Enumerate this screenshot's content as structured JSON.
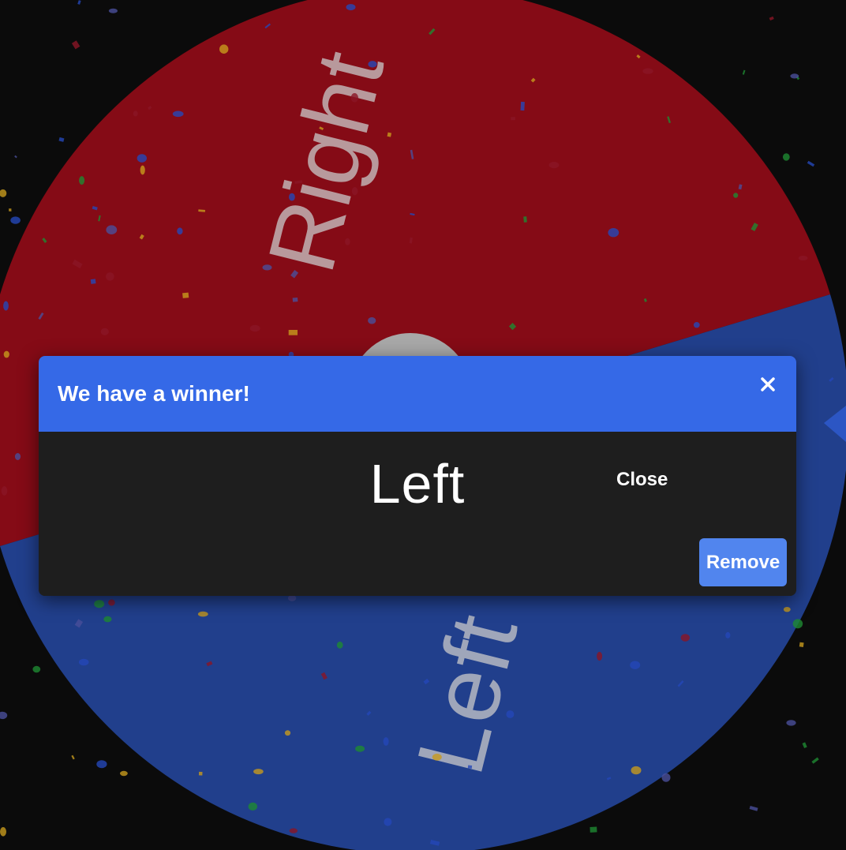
{
  "wheel": {
    "segments": [
      {
        "label": "Right",
        "color": "#850b16"
      },
      {
        "label": "Left",
        "color": "#213f8c"
      }
    ],
    "overlay_dim": true,
    "center_hub_color": "#a8a8a8"
  },
  "confetti_colors": [
    "#1e8a32",
    "#c79a1d",
    "#2447b8",
    "#8a1525",
    "#4a4f9a"
  ],
  "dialog": {
    "title": "We have a winner!",
    "close_icon": "close-icon",
    "winner": "Left",
    "close_label": "Close",
    "remove_label": "Remove"
  },
  "colors": {
    "header": "#3569e7",
    "body": "#1e1e1e",
    "remove_button": "#5185ee",
    "backdrop": "#0b0b0b"
  }
}
